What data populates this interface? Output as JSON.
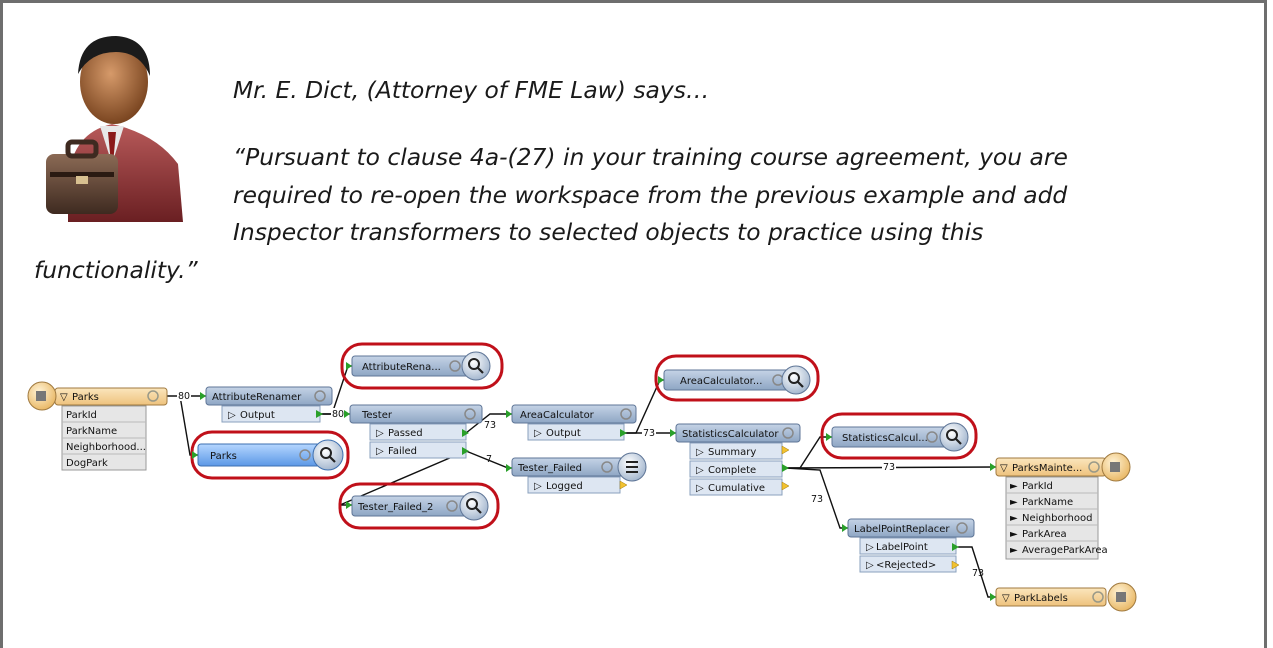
{
  "quote": {
    "speaker": "Mr. E. Dict, (Attorney of FME Law) says…",
    "line1": "“Pursuant to clause 4a-(27) in your training course agreement, you are",
    "line2": "required to re-open the workspace from the previous example and add",
    "line3": "Inspector transformers to selected objects to practice using this",
    "line4": "functionality.”"
  },
  "workspace": {
    "reader_parks": {
      "name": "Parks",
      "attrs": [
        "ParkId",
        "ParkName",
        "Neighborhood...",
        "DogPark"
      ]
    },
    "attribute_renamer": {
      "name": "AttributeRenamer",
      "port": "Output"
    },
    "inspector_attr": {
      "name": "AttributeRena..."
    },
    "inspector_parks": {
      "name": "Parks"
    },
    "tester": {
      "name": "Tester",
      "ports": [
        "Passed",
        "Failed"
      ]
    },
    "tester_failed": {
      "name": "Tester_Failed",
      "port": "Logged"
    },
    "inspector_tester_failed": {
      "name": "Tester_Failed_2"
    },
    "area_calc": {
      "name": "AreaCalculator",
      "port": "Output"
    },
    "inspector_area": {
      "name": "AreaCalculator..."
    },
    "stats_calc": {
      "name": "StatisticsCalculator",
      "ports": [
        "Summary",
        "Complete",
        "Cumulative"
      ]
    },
    "inspector_stats": {
      "name": "StatisticsCalcul..."
    },
    "writer_parks": {
      "name": "ParksMainte...",
      "attrs": [
        "ParkId",
        "ParkName",
        "Neighborhood",
        "ParkArea",
        "AverageParkArea"
      ]
    },
    "label_point": {
      "name": "LabelPointReplacer",
      "ports": [
        "LabelPoint",
        "<Rejected>"
      ]
    },
    "writer_labels": {
      "name": "ParkLabels"
    },
    "counts": {
      "c80a": "80",
      "c80b": "80",
      "c73a": "73",
      "c7": "7",
      "c73b": "73",
      "c73c": "73",
      "c73d": "73",
      "c73e": "73"
    }
  },
  "colors": {
    "highlight": "#c0101a",
    "transformer": "#8ea6c4",
    "reader": "#f5d39a",
    "selected": "#79aeeb"
  }
}
